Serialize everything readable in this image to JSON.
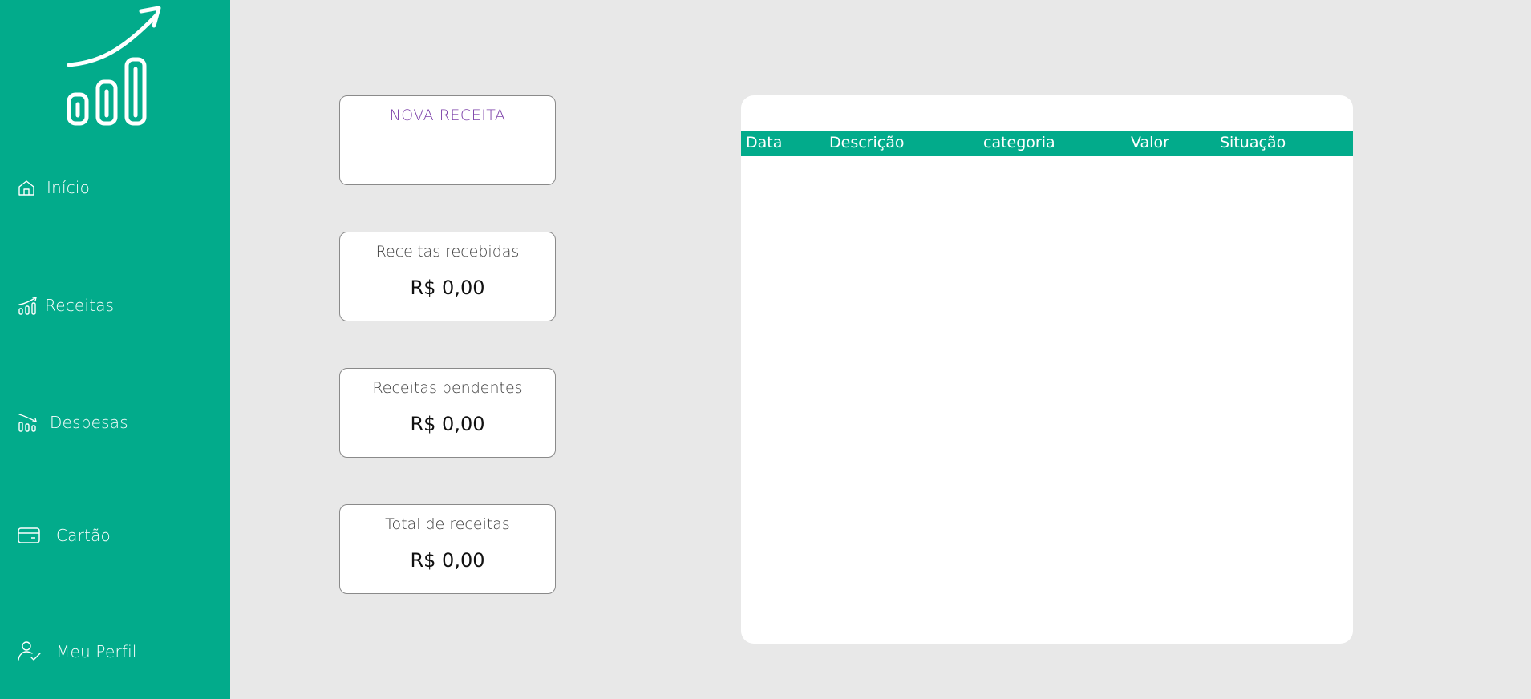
{
  "sidebar": {
    "logo": "growth-chart-logo",
    "items": [
      {
        "label": "Início",
        "icon": "home-icon"
      },
      {
        "label": "Receitas",
        "icon": "chart-up-icon"
      },
      {
        "label": "Despesas",
        "icon": "chart-down-icon"
      },
      {
        "label": "Cartão",
        "icon": "credit-card-icon"
      },
      {
        "label": "Meu Perfil",
        "icon": "user-check-icon"
      }
    ]
  },
  "cards": {
    "new_income": {
      "title": "NOVA RECEITA"
    },
    "received": {
      "title": "Receitas recebidas",
      "value": "R$ 0,00"
    },
    "pending": {
      "title": "Receitas pendentes",
      "value": "R$ 0,00"
    },
    "total": {
      "title": "Total de receitas",
      "value": "R$ 0,00"
    }
  },
  "table": {
    "columns": [
      "Data",
      "Descrição",
      "categoria",
      "Valor",
      "Situação"
    ],
    "rows": []
  },
  "colors": {
    "brand": "#02ab8b",
    "background": "#e8e8e8",
    "accent_purple": "#7b3fa8"
  }
}
